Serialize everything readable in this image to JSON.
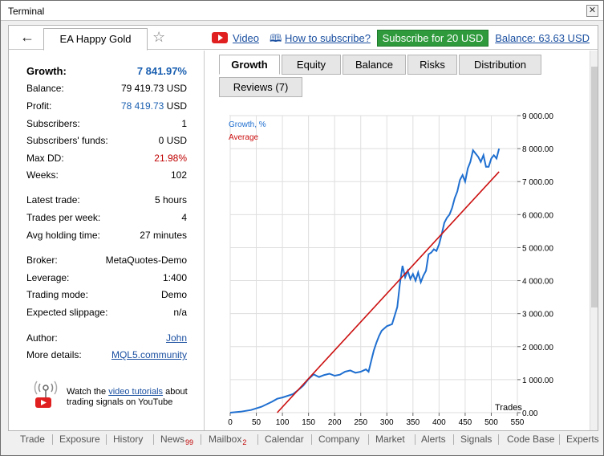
{
  "window": {
    "title": "Terminal"
  },
  "toolbar": {
    "tab_name": "EA Happy Gold",
    "video_label": "Video",
    "howto_label": "How to subscribe?",
    "subscribe_label": "Subscribe for 20 USD",
    "balance_label": "Balance: 63.63 USD"
  },
  "stats": {
    "growth": {
      "label": "Growth:",
      "value": "7 841.97%"
    },
    "balance": {
      "label": "Balance:",
      "value": "79 419.73 USD"
    },
    "profit": {
      "label": "Profit:",
      "value": "78 419.73",
      "unit": "USD"
    },
    "subscribers": {
      "label": "Subscribers:",
      "value": "1"
    },
    "subscribers_funds": {
      "label": "Subscribers' funds:",
      "value": "0 USD"
    },
    "max_dd": {
      "label": "Max DD:",
      "value": "21.98%"
    },
    "weeks": {
      "label": "Weeks:",
      "value": "102"
    },
    "latest_trade": {
      "label": "Latest trade:",
      "value": "5 hours"
    },
    "trades_per_week": {
      "label": "Trades per week:",
      "value": "4"
    },
    "avg_holding": {
      "label": "Avg holding time:",
      "value": "27 minutes"
    },
    "broker": {
      "label": "Broker:",
      "value": "MetaQuotes-Demo"
    },
    "leverage": {
      "label": "Leverage:",
      "value": "1:400"
    },
    "trading_mode": {
      "label": "Trading mode:",
      "value": "Demo"
    },
    "slippage": {
      "label": "Expected slippage:",
      "value": "n/a"
    },
    "author": {
      "label": "Author:",
      "value": "John"
    },
    "more_details": {
      "label": "More details:",
      "value": "MQL5.community"
    }
  },
  "help": {
    "text_before": "Watch the",
    "link": "video tutorials",
    "text_after": "about trading signals on YouTube"
  },
  "tabs": [
    {
      "label": "Growth",
      "active": true
    },
    {
      "label": "Equity",
      "active": false
    },
    {
      "label": "Balance",
      "active": false
    },
    {
      "label": "Risks",
      "active": false
    },
    {
      "label": "Distribution",
      "active": false
    },
    {
      "label": "Reviews (7)",
      "active": false
    }
  ],
  "chart_data": {
    "type": "line",
    "xlabel": "Trades",
    "xlim": [
      0,
      550
    ],
    "ylim": [
      0,
      9000
    ],
    "x_ticks": [
      0,
      50,
      100,
      150,
      200,
      250,
      300,
      350,
      400,
      450,
      500,
      550
    ],
    "y_ticks": [
      "0.00",
      "1 000.00",
      "2 000.00",
      "3 000.00",
      "4 000.00",
      "5 000.00",
      "6 000.00",
      "7 000.00",
      "8 000.00",
      "9 000.00"
    ],
    "grid": true,
    "legend_placement": "top-left",
    "series": [
      {
        "name": "Growth, %",
        "color": "#1f6fd0",
        "x": [
          0,
          20,
          40,
          60,
          80,
          90,
          100,
          120,
          130,
          140,
          150,
          160,
          170,
          180,
          190,
          200,
          210,
          220,
          230,
          240,
          250,
          260,
          265,
          270,
          275,
          280,
          285,
          290,
          300,
          310,
          320,
          325,
          330,
          335,
          340,
          345,
          350,
          355,
          360,
          365,
          370,
          375,
          380,
          385,
          390,
          395,
          400,
          405,
          410,
          415,
          420,
          425,
          430,
          435,
          440,
          445,
          450,
          455,
          460,
          465,
          470,
          475,
          480,
          485,
          490,
          495,
          500,
          505,
          510,
          515
        ],
        "values": [
          0,
          30,
          80,
          180,
          330,
          420,
          460,
          560,
          680,
          820,
          1020,
          1160,
          1080,
          1140,
          1180,
          1120,
          1150,
          1240,
          1280,
          1210,
          1240,
          1310,
          1240,
          1560,
          1880,
          2120,
          2320,
          2480,
          2620,
          2680,
          3200,
          3900,
          4450,
          4100,
          4300,
          4050,
          4200,
          4000,
          4250,
          3950,
          4150,
          4300,
          4800,
          4850,
          4950,
          4900,
          5100,
          5400,
          5750,
          5900,
          6000,
          6200,
          6500,
          6700,
          7050,
          7200,
          7000,
          7400,
          7600,
          7950,
          7850,
          7750,
          7600,
          7800,
          7450,
          7450,
          7700,
          7800,
          7700,
          8000
        ]
      },
      {
        "name": "Average",
        "color": "#cc1010",
        "x": [
          90,
          515
        ],
        "values": [
          0,
          7300
        ]
      }
    ]
  },
  "bottom_tabs": [
    {
      "label": "Trade"
    },
    {
      "label": "Exposure"
    },
    {
      "label": "History"
    },
    {
      "label": "News",
      "badge": "99"
    },
    {
      "label": "Mailbox",
      "badge": "2"
    },
    {
      "label": "Calendar"
    },
    {
      "label": "Company"
    },
    {
      "label": "Market"
    },
    {
      "label": "Alerts"
    },
    {
      "label": "Signals"
    },
    {
      "label": "Code Base"
    },
    {
      "label": "Experts"
    }
  ]
}
